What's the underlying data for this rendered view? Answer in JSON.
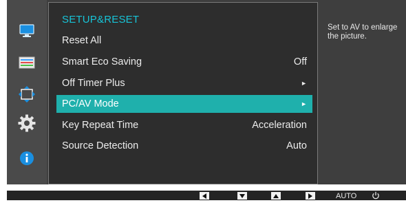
{
  "menu": {
    "title": "SETUP&RESET",
    "items": [
      {
        "label": "Reset All",
        "value": ""
      },
      {
        "label": "Smart Eco Saving",
        "value": "Off"
      },
      {
        "label": "Off Timer Plus",
        "value": "►"
      },
      {
        "label": "PC/AV Mode",
        "value": "►"
      },
      {
        "label": "Key Repeat Time",
        "value": "Acceleration"
      },
      {
        "label": "Source Detection",
        "value": "Auto"
      }
    ],
    "selected_index": 3
  },
  "help": {
    "text": "Set to AV to enlarge the picture."
  },
  "sidebar": {
    "items": [
      {
        "icon": "monitor-icon"
      },
      {
        "icon": "color-bars-icon"
      },
      {
        "icon": "size-position-icon"
      },
      {
        "icon": "gear-icon"
      },
      {
        "icon": "info-icon"
      }
    ]
  },
  "keybar": {
    "left_icon": "triangle-left-icon",
    "down_icon": "triangle-down-icon",
    "up_icon": "triangle-up-icon",
    "right_icon": "triangle-right-icon",
    "auto_label": "AUTO",
    "power_icon": "power-icon"
  },
  "colors": {
    "accent": "#17c4d8",
    "selection": "#1fb0ac",
    "background": "#3e3e3e"
  }
}
